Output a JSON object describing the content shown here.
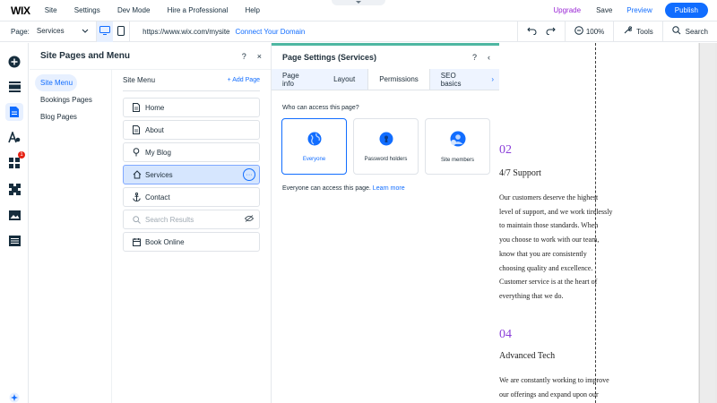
{
  "topbar": {
    "logo": "WIX",
    "menu": [
      "Site",
      "Settings",
      "Dev Mode",
      "Hire a Professional",
      "Help"
    ],
    "upgrade": "Upgrade",
    "save": "Save",
    "preview": "Preview",
    "publish": "Publish"
  },
  "bar2": {
    "page_label": "Page:",
    "page_value": "Services",
    "url": "https://www.wix.com/mysite",
    "connect": "Connect Your Domain",
    "zoom": "100%",
    "tools": "Tools",
    "search": "Search"
  },
  "rail": {
    "badge": "1"
  },
  "panel1": {
    "title": "Site Pages and Menu",
    "help": "?",
    "close": "×",
    "nav": [
      "Site Menu",
      "Bookings Pages",
      "Blog Pages"
    ],
    "site_menu_label": "Site Menu",
    "add_page": "+ Add Page",
    "pages": [
      {
        "label": "Home",
        "icon": "page-icon"
      },
      {
        "label": "About",
        "icon": "page-icon"
      },
      {
        "label": "My Blog",
        "icon": "pin-icon"
      },
      {
        "label": "Services",
        "icon": "home-icon"
      },
      {
        "label": "Contact",
        "icon": "anchor-icon"
      },
      {
        "label": "Search Results",
        "icon": "search-icon"
      },
      {
        "label": "Book Online",
        "icon": "calendar-icon"
      }
    ],
    "more": "···"
  },
  "panel2": {
    "title": "Page Settings (Services)",
    "help": "?",
    "back": "‹",
    "tabs": [
      "Page info",
      "Layout",
      "Permissions",
      "SEO basics"
    ],
    "tab_arrow": "›",
    "question": "Who can access this page?",
    "options": [
      "Everyone",
      "Password holders",
      "Site members"
    ],
    "access_text": "Everyone can access this page.",
    "learn_more": "Learn more"
  },
  "canvas": {
    "num1": "02",
    "title1": "4/7 Support",
    "body1": "Our customers deserve the highest\nlevel of support, and we work tirelessly\nto maintain those standards. When\nyou choose to work with our team,\nknow that you are consistently\nchoosing quality and excellence.\nCustomer service is at the heart of\neverything that we do.",
    "num2": "04",
    "title2": "Advanced Tech",
    "body2": "We are constantly working to improve\nour offerings and expand upon our"
  },
  "colors": {
    "accent": "#116dff",
    "upgrade": "#9a27d5",
    "panel_top": "#4eb7a2",
    "canvas_num": "#8b3fd9"
  }
}
